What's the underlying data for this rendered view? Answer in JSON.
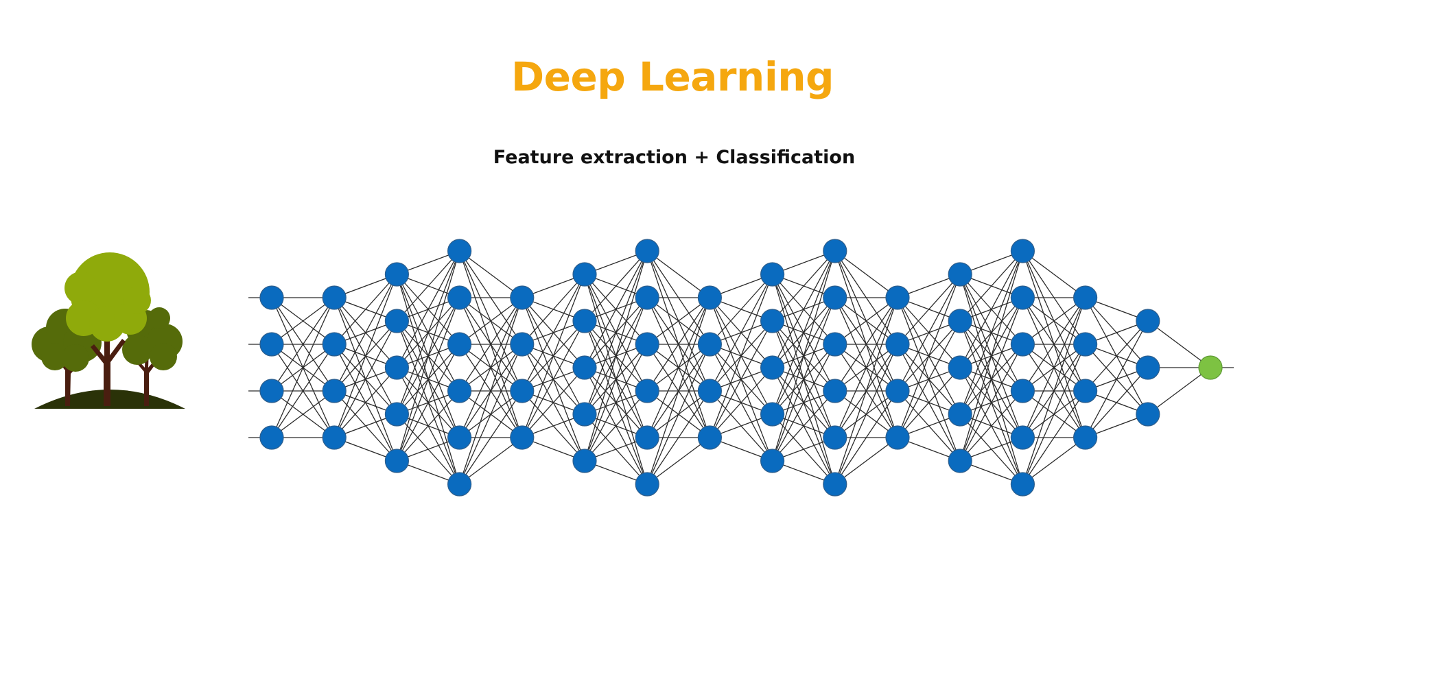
{
  "slide": {
    "title": "Deep Learning",
    "subtitle": "Feature extraction + Classification"
  },
  "colors": {
    "title": "#F5A70F",
    "subtitle": "#111111",
    "node_fill": "#0A6BBF",
    "node_stroke": "#2E5E8C",
    "output_fill": "#7DC242",
    "output_stroke": "#5E9A35",
    "edge": "#2b2b2b",
    "tree_dark": "#556B0A",
    "tree_light": "#8FAA0B",
    "trunk": "#4A1E10",
    "ground": "#2A3208"
  },
  "icons": {
    "input_image": "trees-icon"
  },
  "network": {
    "layer_node_counts": [
      4,
      4,
      5,
      6,
      4,
      5,
      6,
      4,
      5,
      6,
      4,
      5,
      6,
      4,
      3,
      1
    ],
    "fully_connected": true,
    "output_node_count": 1,
    "input_arrows": 4,
    "output_arrows": 1
  }
}
